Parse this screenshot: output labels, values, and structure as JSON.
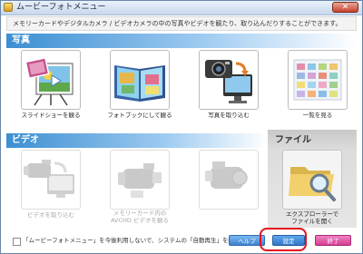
{
  "window": {
    "title": "ムービーフォトメニュー",
    "close_symbol": "✕"
  },
  "description": "メモリーカードやデジタルカメラ / ビデオカメラの中の写真やビデオを観たり、取り込んだりすることができます。",
  "sections": {
    "photo": "写真",
    "video": "ビデオ",
    "file": "ファイル"
  },
  "photo_items": [
    {
      "label": "スライドショーを観る"
    },
    {
      "label": "フォトブックにして観る"
    },
    {
      "label": "写真を取り込む"
    },
    {
      "label": "一覧を見る"
    }
  ],
  "video_items": [
    {
      "label": "ビデオを取り込む"
    },
    {
      "label_line1": "メモリーカード内の",
      "label_line2": "AVCHD ビデオを観る"
    },
    {
      "label": ""
    }
  ],
  "file_item": {
    "label_line1": "エクスプローラーで",
    "label_line2": "ファイルを開く"
  },
  "footer": {
    "checkbox_label": "「ムービーフォトメニュー」を今後利用しないで、システムの「自動再生」を使う",
    "help_label": "ヘルプ",
    "settings_label": "設定",
    "exit_label": "終了"
  }
}
